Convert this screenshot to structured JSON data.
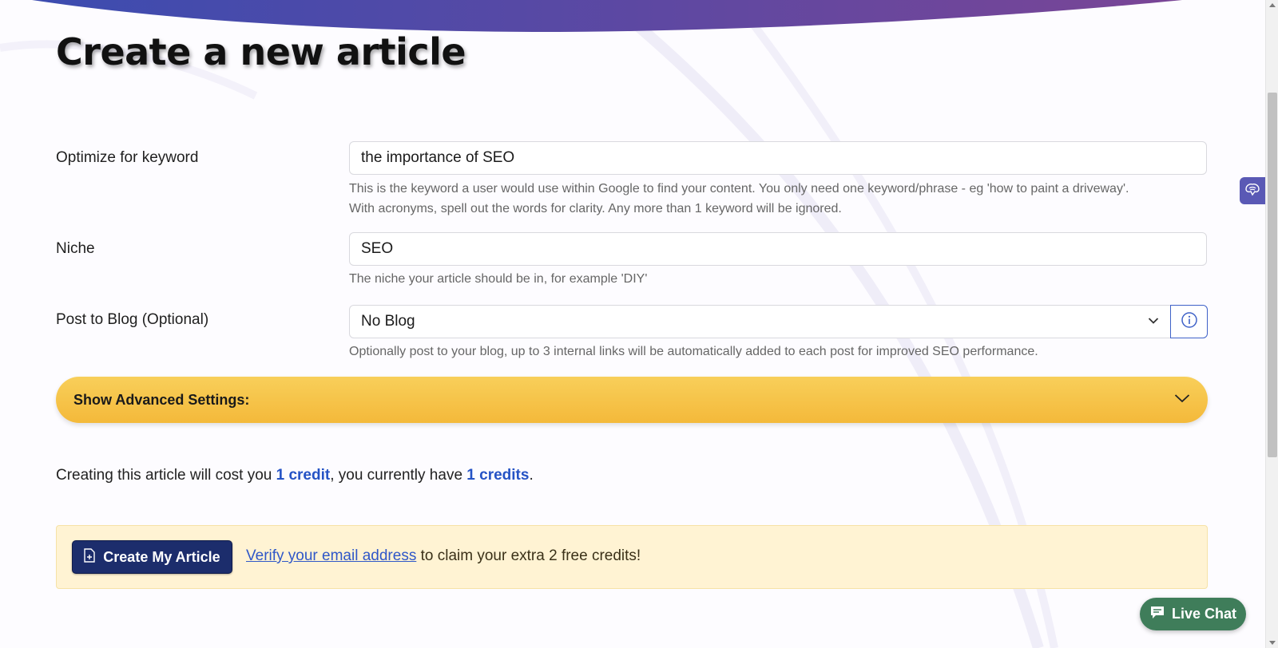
{
  "page": {
    "title": "Create a new article"
  },
  "keyword": {
    "label": "Optimize for keyword",
    "value": "the importance of SEO",
    "help_line1": "This is the keyword a user would use within Google to find your content. You only need one keyword/phrase - eg 'how to paint a driveway'.",
    "help_line2": "With acronyms, spell out the words for clarity. Any more than 1 keyword will be ignored."
  },
  "niche": {
    "label": "Niche",
    "value": "SEO",
    "help": "The niche your article should be in, for example 'DIY'"
  },
  "blog": {
    "label": "Post to Blog (Optional)",
    "selected": "No Blog",
    "help": "Optionally post to your blog, up to 3 internal links will be automatically added to each post for improved SEO performance."
  },
  "advanced": {
    "label": "Show Advanced Settings:"
  },
  "cost": {
    "prefix": "Creating this article will cost you ",
    "cost_value": "1 credit",
    "middle": ", you currently have ",
    "have_value": "1 credits",
    "suffix": "."
  },
  "notice": {
    "button_label": "Create My Article",
    "link_text": "Verify your email address",
    "text_after": " to claim your extra 2 free credits!"
  },
  "live_chat": {
    "label": "Live Chat"
  },
  "colors": {
    "banner_start": "#3c4cb0",
    "banner_end": "#7a4596",
    "accent_yellow": "#f6c54a",
    "button_navy": "#1c2d6c",
    "link_blue": "#2f57c8",
    "chat_green": "#3f7d5a"
  },
  "icons": {
    "info": "info-circle-icon",
    "chevron": "chevron-down-icon",
    "document": "document-plus-icon",
    "chat": "chat-bubble-icon",
    "side_tab": "brain-icon"
  }
}
